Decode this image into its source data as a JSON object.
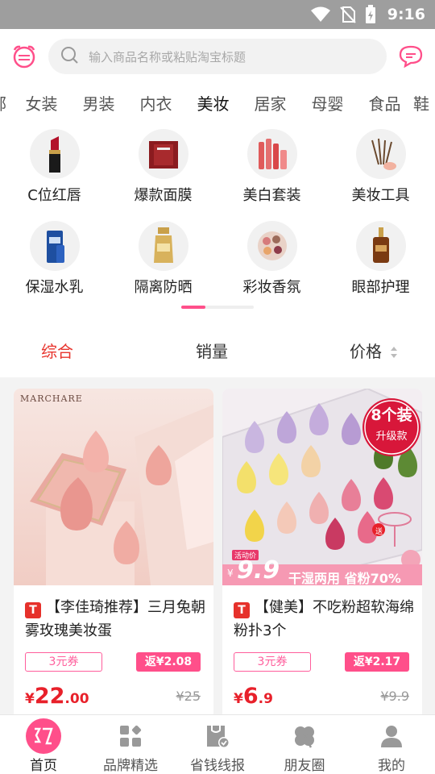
{
  "status_bar": {
    "time": "9:16",
    "icons": [
      "wifi-icon",
      "no-sim-icon",
      "battery-icon"
    ]
  },
  "header": {
    "logo_icon": "alarm-clock-logo-icon",
    "search_placeholder": "输入商品名称或粘贴淘宝标题",
    "message_icon": "chat-bubble-icon"
  },
  "categories": {
    "items": [
      "鄂",
      "女装",
      "男装",
      "内衣",
      "美妆",
      "居家",
      "母婴",
      "食品",
      "鞋"
    ],
    "active": "美妆"
  },
  "subcategories": [
    {
      "label": "C位红唇",
      "icon": "lipstick-icon"
    },
    {
      "label": "爆款面膜",
      "icon": "face-mask-icon"
    },
    {
      "label": "美白套装",
      "icon": "skincare-set-icon"
    },
    {
      "label": "美妆工具",
      "icon": "makeup-brush-icon"
    },
    {
      "label": "保湿水乳",
      "icon": "lotion-bottle-icon"
    },
    {
      "label": "隔离防晒",
      "icon": "sunscreen-icon"
    },
    {
      "label": "彩妆香氛",
      "icon": "eyeshadow-palette-icon"
    },
    {
      "label": "眼部护理",
      "icon": "eye-serum-icon"
    }
  ],
  "sort": {
    "overall": "综合",
    "sales": "销量",
    "price": "价格"
  },
  "products": [
    {
      "brand_text": "MARCHARE",
      "badge": "T",
      "title": "【李佳琦推荐】三月兔朝雾玫瑰美妆蛋",
      "coupon": "3元券",
      "rebate": "返¥2.08",
      "price_currency": "¥",
      "price_int": "22",
      "price_dec": ".00",
      "original_price": "¥25"
    },
    {
      "badge": "T",
      "title": "【健美】不吃粉超软海绵粉扑3个",
      "coupon": "3元券",
      "rebate": "返¥2.17",
      "price_currency": "¥",
      "price_int": "6",
      "price_dec": ".9",
      "original_price": "¥9.9",
      "promo": {
        "pack_main": "8个装",
        "pack_sub": "升级款",
        "activity_label": "活动价",
        "activity_price": "9.9",
        "activity_currency": "¥",
        "promo_text": "干湿两用 省粉70%",
        "gift_label": "送"
      }
    }
  ],
  "bottom_nav": [
    {
      "label": "首页",
      "icon": "home-rebate-icon",
      "active": true
    },
    {
      "label": "品牌精选",
      "icon": "brand-grid-icon",
      "active": false
    },
    {
      "label": "省钱线报",
      "icon": "savings-bag-icon",
      "active": false
    },
    {
      "label": "朋友圈",
      "icon": "clover-icon",
      "active": false
    },
    {
      "label": "我的",
      "icon": "profile-icon",
      "active": false
    }
  ],
  "colors": {
    "accent": "#ff4f8a",
    "price_red": "#e8202a",
    "active_sort": "#e8352e"
  }
}
